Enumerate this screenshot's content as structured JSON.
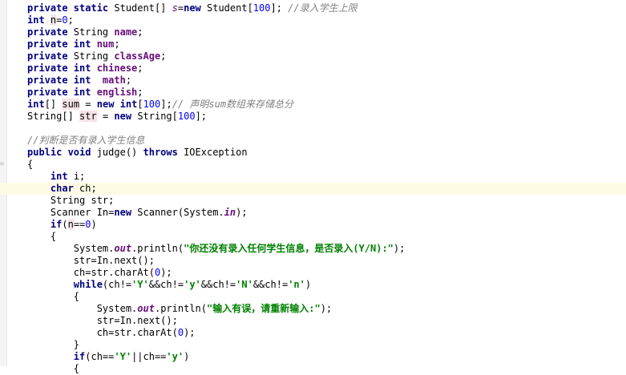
{
  "editor": {
    "language": "Java",
    "current_line": 15,
    "lines": [
      [
        [
          "kw",
          "private static "
        ],
        [
          "t",
          "Student[] "
        ],
        [
          "static-var",
          "s"
        ],
        [
          "t",
          "="
        ],
        [
          "kw",
          "new "
        ],
        [
          "t",
          "Student["
        ],
        [
          "num",
          "100"
        ],
        [
          "t",
          "]; "
        ],
        [
          "cmt",
          "//录入学生上限"
        ]
      ],
      [
        [
          "kw",
          "int "
        ],
        [
          "hl",
          "n"
        ],
        [
          "t",
          "="
        ],
        [
          "num",
          "0"
        ],
        [
          "t",
          ";"
        ]
      ],
      [
        [
          "kw",
          "private "
        ],
        [
          "t",
          "String "
        ],
        [
          "fld",
          "name"
        ],
        [
          "t",
          ";"
        ]
      ],
      [
        [
          "kw",
          "private int "
        ],
        [
          "fld",
          "num"
        ],
        [
          "t",
          ";"
        ]
      ],
      [
        [
          "kw",
          "private "
        ],
        [
          "t",
          "String "
        ],
        [
          "fld",
          "classAge"
        ],
        [
          "t",
          ";"
        ]
      ],
      [
        [
          "kw",
          "private int "
        ],
        [
          "fld",
          "chinese"
        ],
        [
          "t",
          ";"
        ]
      ],
      [
        [
          "kw",
          "private int  "
        ],
        [
          "fld",
          "math"
        ],
        [
          "t",
          ";"
        ]
      ],
      [
        [
          "kw",
          "private int "
        ],
        [
          "fld",
          "english"
        ],
        [
          "t",
          ";"
        ]
      ],
      [
        [
          "kw",
          "int"
        ],
        [
          "t",
          "[] "
        ],
        [
          "hl",
          "sum"
        ],
        [
          "t",
          " = "
        ],
        [
          "kw",
          "new int"
        ],
        [
          "t",
          "["
        ],
        [
          "num",
          "100"
        ],
        [
          "t",
          "];"
        ],
        [
          "cmt",
          "// 声明sum数组来存储总分"
        ]
      ],
      [
        [
          "t",
          "String[] "
        ],
        [
          "hl",
          "str"
        ],
        [
          "t",
          " = "
        ],
        [
          "kw",
          "new "
        ],
        [
          "t",
          "String["
        ],
        [
          "num",
          "100"
        ],
        [
          "t",
          "];"
        ]
      ],
      [],
      [
        [
          "cmt",
          "//判断是否有录入学生信息"
        ]
      ],
      [
        [
          "kw",
          "public void "
        ],
        [
          "t",
          "judge() "
        ],
        [
          "kw",
          "throws "
        ],
        [
          "t",
          "IOException"
        ]
      ],
      [
        [
          "t",
          "{"
        ]
      ],
      [
        [
          "t",
          "    "
        ],
        [
          "kw",
          "int "
        ],
        [
          "t",
          "i;"
        ]
      ],
      [
        [
          "t",
          "    "
        ],
        [
          "kw",
          "char "
        ],
        [
          "t",
          "ch;"
        ]
      ],
      [
        [
          "t",
          "    String str;"
        ]
      ],
      [
        [
          "t",
          "    Scanner In="
        ],
        [
          "kw",
          "new "
        ],
        [
          "t",
          "Scanner(System."
        ],
        [
          "sfld",
          "in"
        ],
        [
          "t",
          ");"
        ]
      ],
      [
        [
          "t",
          "    "
        ],
        [
          "kw",
          "if"
        ],
        [
          "t",
          "("
        ],
        [
          "hl",
          "n"
        ],
        [
          "t",
          "=="
        ],
        [
          "num",
          "0"
        ],
        [
          "t",
          ")"
        ]
      ],
      [
        [
          "t",
          "    {"
        ]
      ],
      [
        [
          "t",
          "        System."
        ],
        [
          "sfld",
          "out"
        ],
        [
          "t",
          ".println("
        ],
        [
          "str",
          "\"你还没有录入任何学生信息，是否录入(Y/N):\""
        ],
        [
          "t",
          ");"
        ]
      ],
      [
        [
          "t",
          "        str=In.next();"
        ]
      ],
      [
        [
          "t",
          "        ch=str.charAt("
        ],
        [
          "num",
          "0"
        ],
        [
          "t",
          ");"
        ]
      ],
      [
        [
          "t",
          "        "
        ],
        [
          "kw",
          "while"
        ],
        [
          "t",
          "(ch!="
        ],
        [
          "str",
          "'Y'"
        ],
        [
          "t",
          "&&ch!="
        ],
        [
          "str",
          "'y'"
        ],
        [
          "t",
          "&&ch!="
        ],
        [
          "str",
          "'N'"
        ],
        [
          "t",
          "&&ch!="
        ],
        [
          "str",
          "'n'"
        ],
        [
          "t",
          ")"
        ]
      ],
      [
        [
          "t",
          "        {"
        ]
      ],
      [
        [
          "t",
          "            System."
        ],
        [
          "sfld",
          "out"
        ],
        [
          "t",
          ".println("
        ],
        [
          "str",
          "\"输入有误，请重新输入:\""
        ],
        [
          "t",
          ");"
        ]
      ],
      [
        [
          "t",
          "            str=In.next();"
        ]
      ],
      [
        [
          "t",
          "            ch=str.charAt("
        ],
        [
          "num",
          "0"
        ],
        [
          "t",
          ");"
        ]
      ],
      [
        [
          "t",
          "        }"
        ]
      ],
      [
        [
          "t",
          "        "
        ],
        [
          "kw",
          "if"
        ],
        [
          "t",
          "(ch=="
        ],
        [
          "str",
          "'Y'"
        ],
        [
          "t",
          "||ch=="
        ],
        [
          "str",
          "'y'"
        ],
        [
          "t",
          ")"
        ]
      ],
      [
        [
          "t",
          "        {"
        ]
      ]
    ]
  }
}
